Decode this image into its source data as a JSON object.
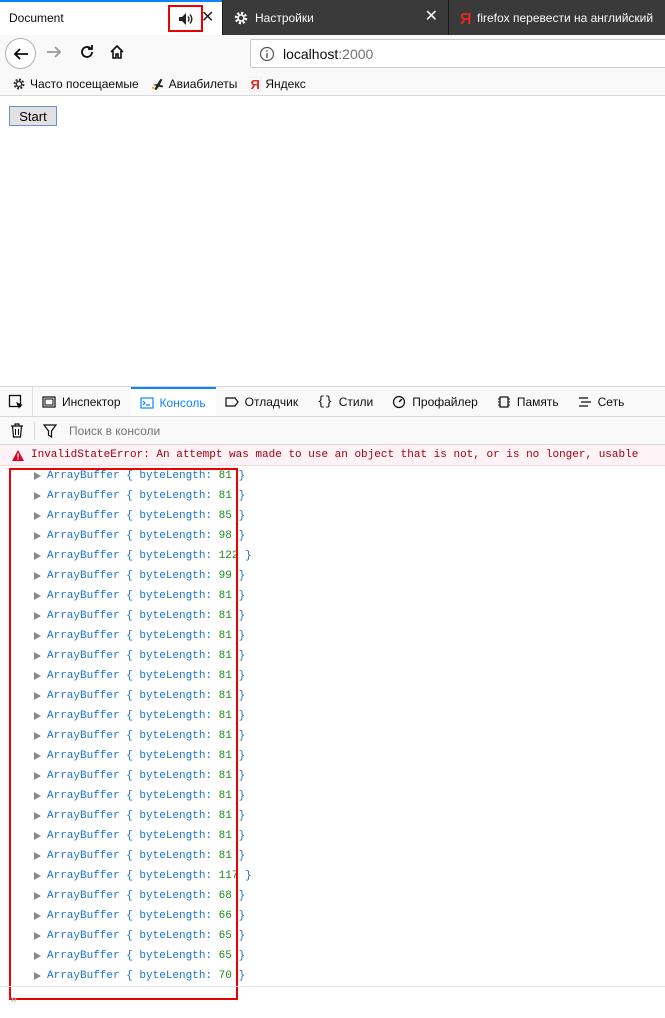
{
  "tabs": {
    "active": {
      "title": "Document",
      "audio_icon": "speaker-icon",
      "close": "✕"
    },
    "tab2": {
      "title": "Настройки",
      "icon": "gear-icon",
      "close": "✕"
    },
    "tab3": {
      "title": "firefox перевести на английский",
      "icon": "yandex-icon"
    }
  },
  "navbar": {
    "url_host": "localhost",
    "url_port": ":2000"
  },
  "bookmarks": [
    {
      "label": "Часто посещаемые",
      "icon": "gear-icon"
    },
    {
      "label": "Авиабилеты",
      "icon": "plane-icon"
    },
    {
      "label": "Яндекс",
      "icon": "yandex-icon"
    }
  ],
  "page": {
    "start_label": "Start"
  },
  "devtools": {
    "tabs": [
      {
        "label": "Инспектор",
        "icon": "inspector-icon"
      },
      {
        "label": "Консоль",
        "icon": "console-icon",
        "selected": true
      },
      {
        "label": "Отладчик",
        "icon": "debugger-icon"
      },
      {
        "label": "Стили",
        "icon": "styles-icon"
      },
      {
        "label": "Профайлер",
        "icon": "profiler-icon"
      },
      {
        "label": "Память",
        "icon": "memory-icon"
      },
      {
        "label": "Сеть",
        "icon": "network-icon"
      }
    ],
    "filter_placeholder": "Поиск в консоли"
  },
  "console": {
    "error": "InvalidStateError: An attempt was made to use an object that is not, or is no longer, usable",
    "entries": [
      81,
      81,
      85,
      98,
      122,
      99,
      81,
      81,
      81,
      81,
      81,
      81,
      81,
      81,
      81,
      81,
      81,
      81,
      81,
      81,
      117,
      68,
      66,
      65,
      65,
      70
    ],
    "entry_prefix": "ArrayBuffer { byteLength: ",
    "entry_suffix": " }",
    "prompt": "»"
  },
  "colors": {
    "accent": "#0a84ff",
    "highlight": "#ee0000",
    "error_text": "#a4000f",
    "object_text": "#1a73c9",
    "number_text": "#1a8a1a"
  }
}
